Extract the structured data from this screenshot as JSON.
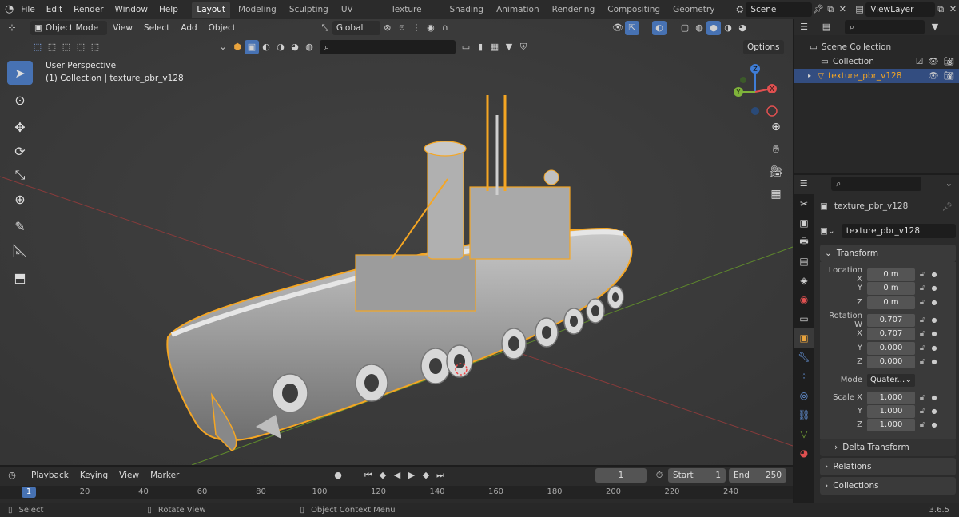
{
  "topbar": {
    "menus": [
      "File",
      "Edit",
      "Render",
      "Window",
      "Help"
    ],
    "workspaces": [
      "Layout",
      "Modeling",
      "Sculpting",
      "UV Editing",
      "Texture Paint",
      "Shading",
      "Animation",
      "Rendering",
      "Compositing",
      "Geometry Noc"
    ],
    "active_workspace": "Layout",
    "scene": "Scene",
    "view_layer": "ViewLayer"
  },
  "viewport_header": {
    "mode": "Object Mode",
    "menus": [
      "View",
      "Select",
      "Add",
      "Object"
    ],
    "orientation": "Global",
    "options": "Options"
  },
  "viewport": {
    "perspective": "User Perspective",
    "collection_info": "(1) Collection | texture_pbr_v128",
    "gizmo": {
      "z": "Z",
      "y": "Y",
      "x": "X"
    }
  },
  "outliner": {
    "scene_collection": "Scene Collection",
    "collection": "Collection",
    "object": "texture_pbr_v128"
  },
  "properties": {
    "object_name": "texture_pbr_v128",
    "data_name": "texture_pbr_v128",
    "transform_label": "Transform",
    "location": {
      "label_x": "Location X",
      "label_y": "Y",
      "label_z": "Z",
      "x": "0 m",
      "y": "0 m",
      "z": "0 m"
    },
    "rotation": {
      "label_w": "Rotation W",
      "label_x": "X",
      "label_y": "Y",
      "label_z": "Z",
      "w": "0.707",
      "x": "0.707",
      "y": "0.000",
      "z": "0.000"
    },
    "mode_label": "Mode",
    "mode_value": "Quater...",
    "scale": {
      "label_x": "Scale X",
      "label_y": "Y",
      "label_z": "Z",
      "x": "1.000",
      "y": "1.000",
      "z": "1.000"
    },
    "delta_transform": "Delta Transform",
    "relations": "Relations",
    "collections": "Collections"
  },
  "timeline": {
    "menus": [
      "Playback",
      "Keying",
      "View",
      "Marker"
    ],
    "current_frame": "1",
    "start_label": "Start",
    "start": "1",
    "end_label": "End",
    "end": "250",
    "ticks": [
      "1",
      "20",
      "40",
      "60",
      "80",
      "100",
      "120",
      "140",
      "160",
      "180",
      "200",
      "220",
      "240"
    ]
  },
  "statusbar": {
    "select": "Select",
    "rotate": "Rotate View",
    "context": "Object Context Menu",
    "version": "3.6.5"
  },
  "colors": {
    "accent": "#4772b3",
    "selection": "#f5a623",
    "bg": "#3d3d3d"
  }
}
